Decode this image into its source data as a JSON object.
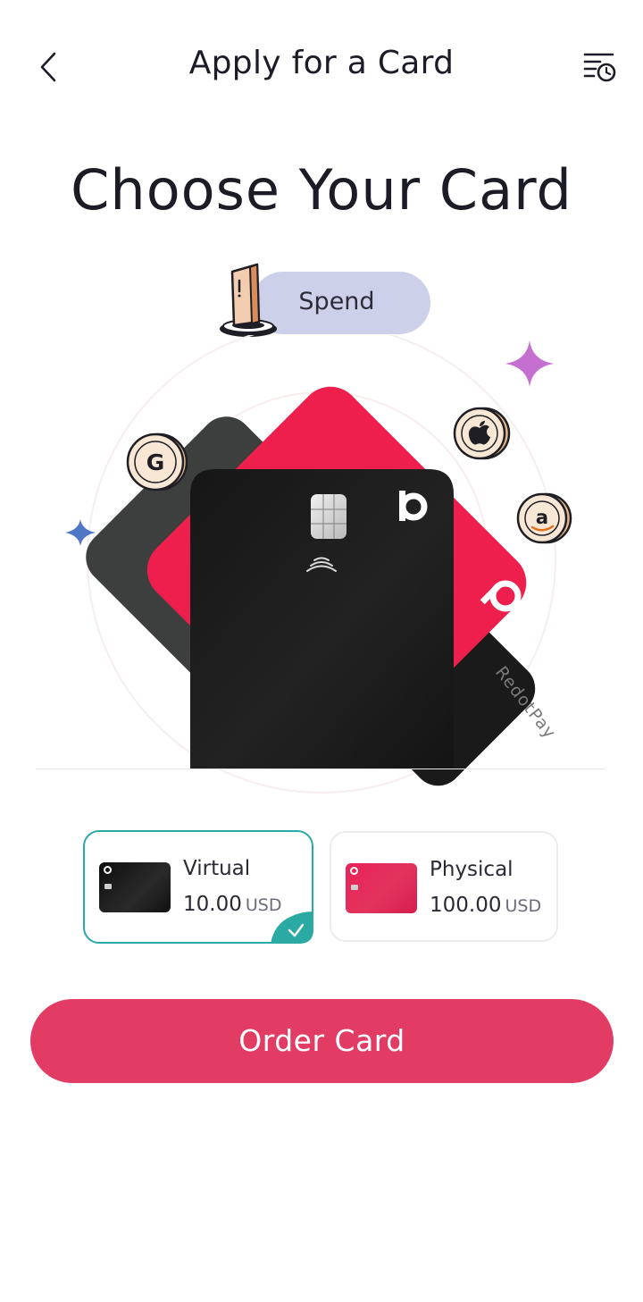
{
  "header": {
    "title": "Apply for a Card",
    "back_icon": "chevron-left-icon",
    "history_icon": "list-clock-icon"
  },
  "page": {
    "title": "Choose Your Card"
  },
  "spend_toggle": {
    "label": "Spend",
    "icon": "card-terminal-icon"
  },
  "illustration": {
    "card_brand": "RedotPay",
    "coin_icons": [
      "google-coin-icon",
      "apple-coin-icon",
      "amazon-coin-icon"
    ]
  },
  "card_options": [
    {
      "name": "Virtual",
      "price": "10.00",
      "currency": "USD",
      "selected": true,
      "color": "#141414"
    },
    {
      "name": "Physical",
      "price": "100.00",
      "currency": "USD",
      "selected": false,
      "color": "#e8215a"
    }
  ],
  "order_button": {
    "label": "Order Card"
  },
  "colors": {
    "accent": "#e23c64",
    "selected_border": "#2aaaa3",
    "pill_bg": "#ccd0e8",
    "card_red": "#ef1f4d",
    "card_black": "#141414"
  }
}
